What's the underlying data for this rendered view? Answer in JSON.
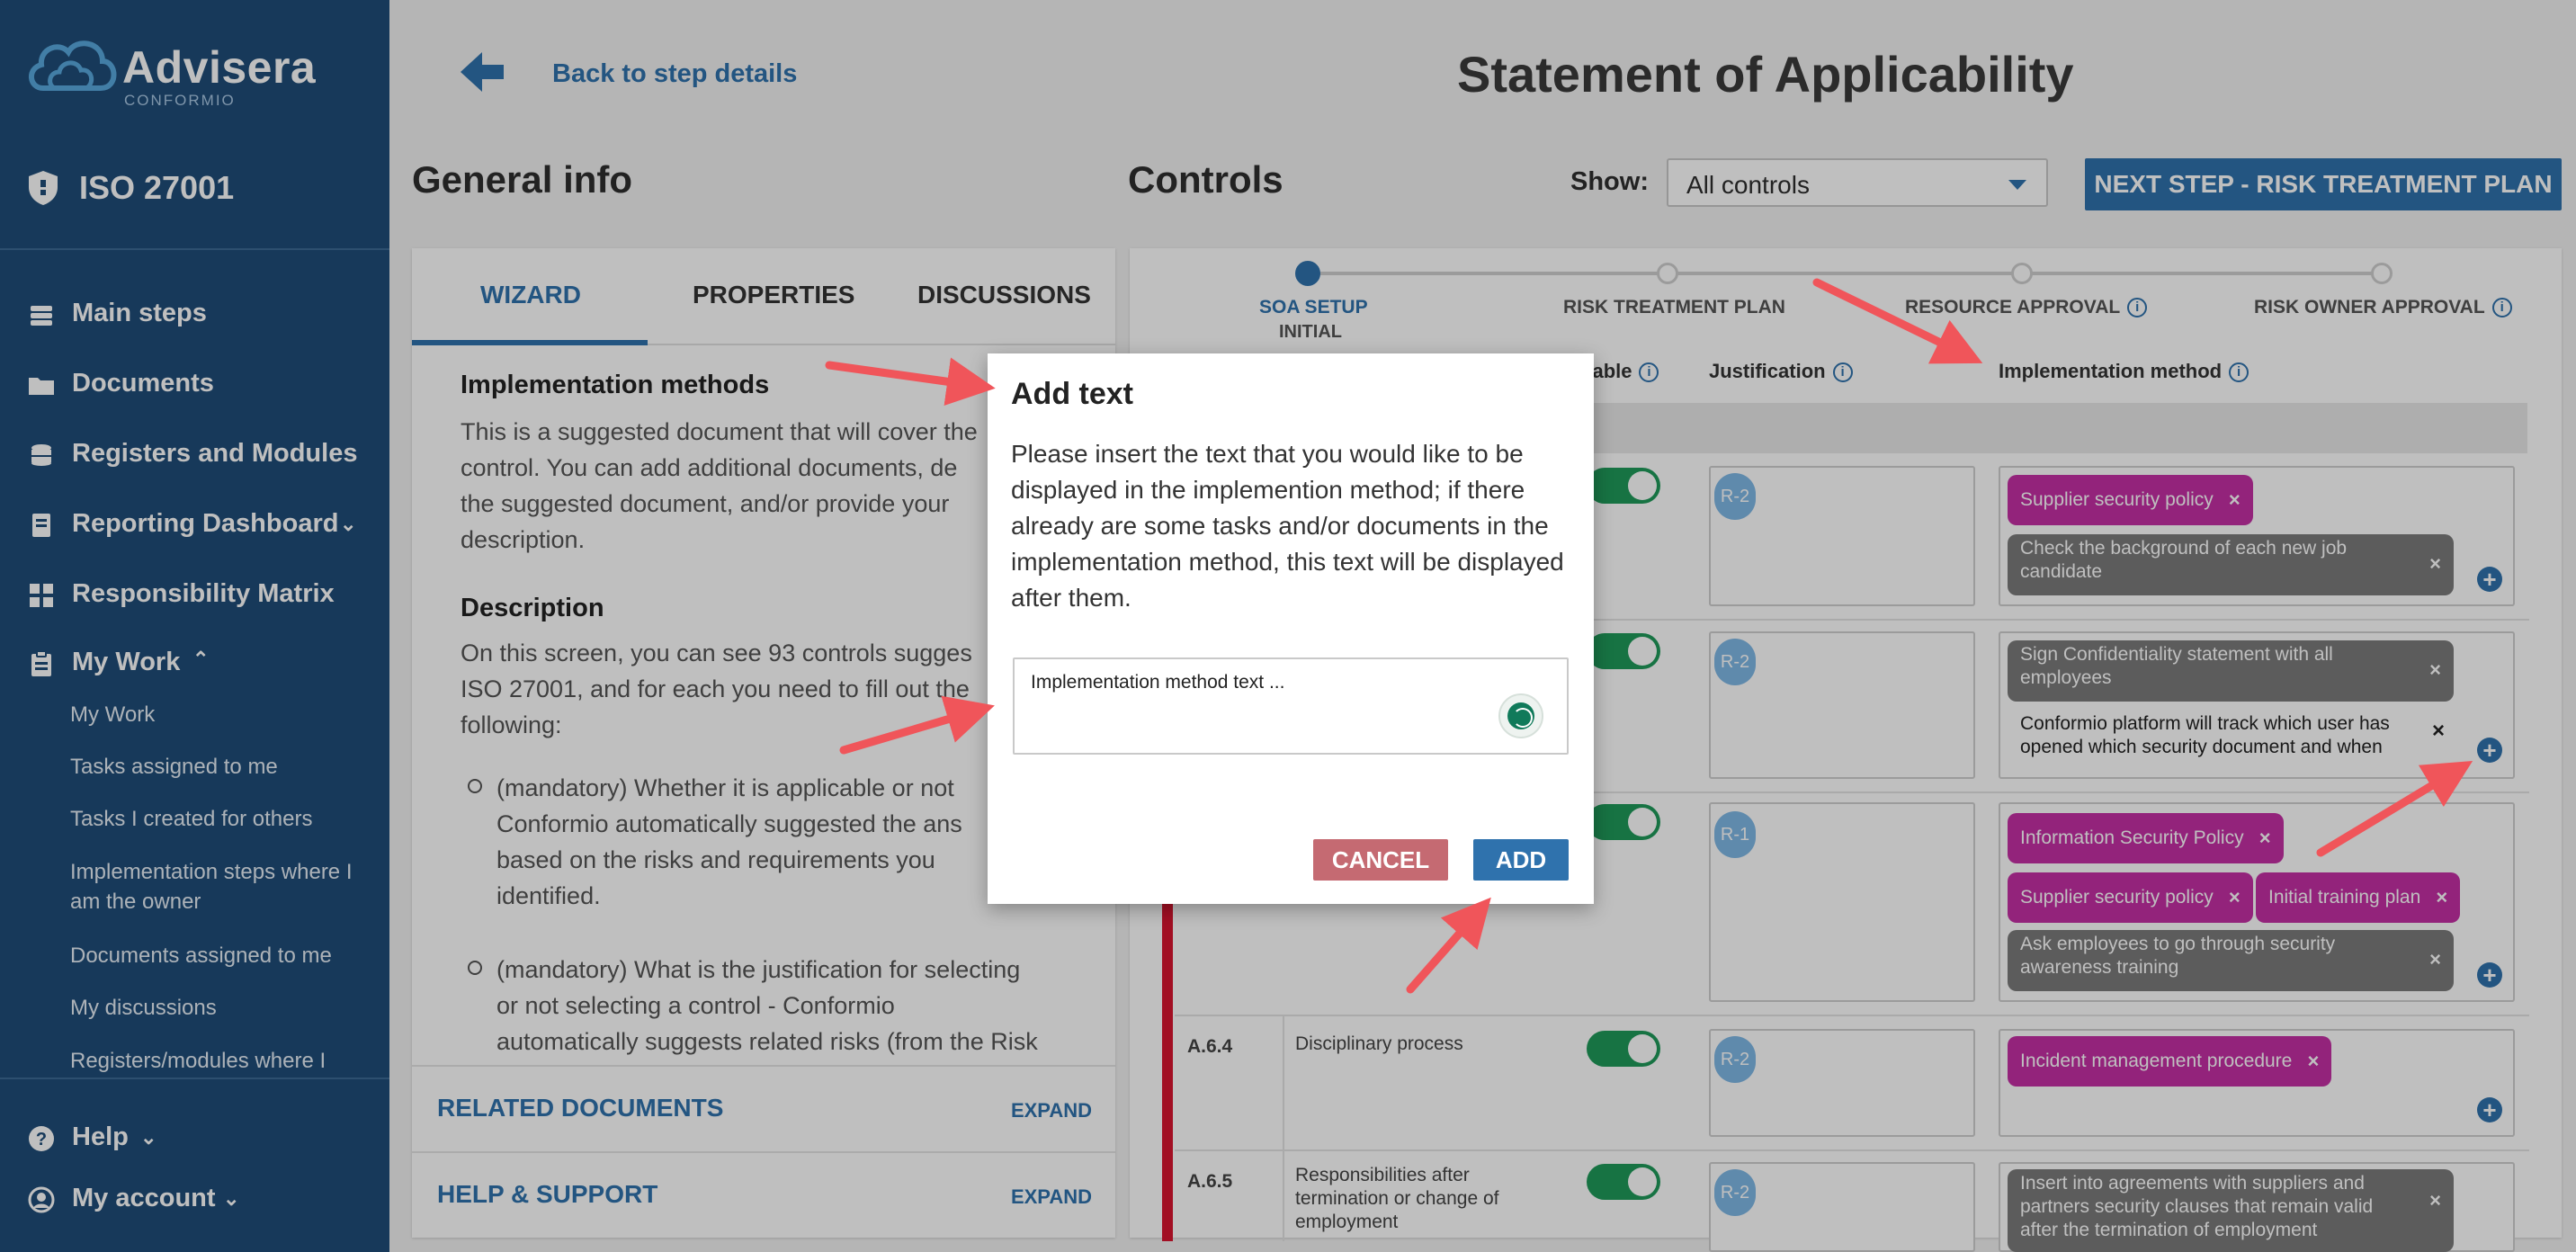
{
  "sidebar": {
    "logo": {
      "brand": "Advisera",
      "sub": "CONFORMIO"
    },
    "product": "ISO 27001",
    "nav": {
      "main_steps": "Main steps",
      "documents": "Documents",
      "registers": "Registers and Modules",
      "reporting": "Reporting Dashboard",
      "responsibility": "Responsibility Matrix",
      "my_work": "My Work",
      "help": "Help",
      "account": "My account"
    },
    "my_work_items": [
      "My Work",
      "Tasks assigned to me",
      "Tasks I created for others",
      "Implementation steps where I am the owner",
      "Documents assigned to me",
      "My discussions",
      "Registers/modules where I"
    ]
  },
  "header": {
    "back": "Back to step details",
    "title": "Statement of Applicability"
  },
  "general_info": {
    "title": "General info",
    "tabs": [
      "WIZARD",
      "PROPERTIES",
      "DISCUSSIONS"
    ],
    "impl_heading": "Implementation methods",
    "impl_lines": [
      "This is a suggested document that will cover the",
      "control. You can add additional documents, de",
      "the suggested document, and/or provide your",
      "description."
    ],
    "desc_heading": "Description",
    "desc_lines": [
      "On this screen, you can see 93 controls sugges",
      "ISO 27001, and for each you need to fill out the",
      "following:"
    ],
    "bullet1": [
      "(mandatory) Whether it is applicable or not",
      "Conformio automatically suggested the ans",
      "based on the risks and requirements you",
      "identified."
    ],
    "bullet2": [
      "(mandatory) What is the justification for selecting",
      "or not selecting a control - Conformio",
      "automatically suggests related risks (from the Risk"
    ],
    "related_docs": "RELATED DOCUMENTS",
    "help_support": "HELP & SUPPORT",
    "expand": "EXPAND"
  },
  "controls": {
    "title": "Controls",
    "show_label": "Show:",
    "show_value": "All controls",
    "next_button": "NEXT STEP - RISK TREATMENT PLAN",
    "steps": [
      {
        "label": "SOA SETUP",
        "sub": "INITIAL"
      },
      {
        "label": "RISK TREATMENT PLAN"
      },
      {
        "label": "RESOURCE APPROVAL"
      },
      {
        "label": "RISK OWNER APPROVAL"
      }
    ],
    "col_applicable": "licable",
    "col_justification": "Justification",
    "col_implementation": "Implementation method",
    "rows": [
      {
        "id": "",
        "name": "",
        "badge": "R-2",
        "chips": [
          "Supplier security policy",
          "Check the background of each new job candidate"
        ]
      },
      {
        "id": "",
        "name": "",
        "badge": "R-2",
        "chips": [
          "Sign Confidentiality statement with all employees"
        ],
        "text": "Conformio platform will track which user has opened which security document and when"
      },
      {
        "id": "",
        "name": "",
        "badge": "R-1",
        "chips": [
          "Information Security Policy",
          "Supplier security policy",
          "Initial training plan",
          "Ask employees to go through security awareness training"
        ]
      },
      {
        "id": "A.6.4",
        "name": "Disciplinary process",
        "badge": "R-2",
        "chips": [
          "Incident management procedure"
        ]
      },
      {
        "id": "A.6.5",
        "name": "Responsibilities after termination or change of employment",
        "badge": "R-2",
        "chips": [
          "Insert into agreements with suppliers and partners security clauses that remain valid after the termination of employment"
        ]
      }
    ]
  },
  "modal": {
    "title": "Add text",
    "prompt": "Please insert the text that you would like to be displayed in the implemention method; if there already are some tasks and/or documents in the implementation method, this text will be displayed after them.",
    "input_placeholder": "Implementation method text ...",
    "cancel": "CANCEL",
    "add": "ADD"
  },
  "colors": {
    "sidebar": "#1f4d78",
    "primary": "#2f72ad",
    "magenta_chip": "#c42fa5",
    "gray_chip": "#7b7b7b",
    "toggle_on": "#1f9a5a",
    "cancel": "#c56a72",
    "annotation_arrow": "#f0555a"
  }
}
